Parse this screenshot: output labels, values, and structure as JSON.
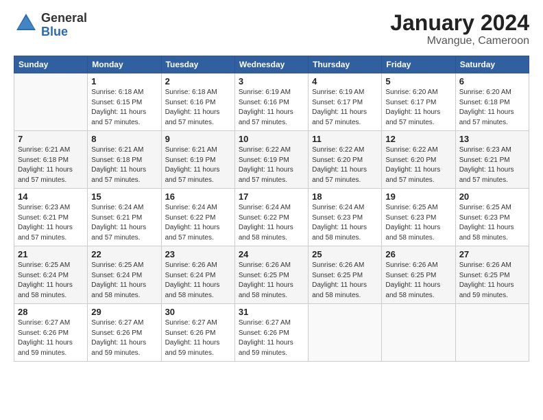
{
  "header": {
    "logo_general": "General",
    "logo_blue": "Blue",
    "month": "January 2024",
    "location": "Mvangue, Cameroon"
  },
  "weekdays": [
    "Sunday",
    "Monday",
    "Tuesday",
    "Wednesday",
    "Thursday",
    "Friday",
    "Saturday"
  ],
  "weeks": [
    [
      {
        "day": "",
        "sunrise": "",
        "sunset": "",
        "daylight": ""
      },
      {
        "day": "1",
        "sunrise": "6:18 AM",
        "sunset": "6:15 PM",
        "daylight": "11 hours and 57 minutes."
      },
      {
        "day": "2",
        "sunrise": "6:18 AM",
        "sunset": "6:16 PM",
        "daylight": "11 hours and 57 minutes."
      },
      {
        "day": "3",
        "sunrise": "6:19 AM",
        "sunset": "6:16 PM",
        "daylight": "11 hours and 57 minutes."
      },
      {
        "day": "4",
        "sunrise": "6:19 AM",
        "sunset": "6:17 PM",
        "daylight": "11 hours and 57 minutes."
      },
      {
        "day": "5",
        "sunrise": "6:20 AM",
        "sunset": "6:17 PM",
        "daylight": "11 hours and 57 minutes."
      },
      {
        "day": "6",
        "sunrise": "6:20 AM",
        "sunset": "6:18 PM",
        "daylight": "11 hours and 57 minutes."
      }
    ],
    [
      {
        "day": "7",
        "sunrise": "6:21 AM",
        "sunset": "6:18 PM",
        "daylight": "11 hours and 57 minutes."
      },
      {
        "day": "8",
        "sunrise": "6:21 AM",
        "sunset": "6:18 PM",
        "daylight": "11 hours and 57 minutes."
      },
      {
        "day": "9",
        "sunrise": "6:21 AM",
        "sunset": "6:19 PM",
        "daylight": "11 hours and 57 minutes."
      },
      {
        "day": "10",
        "sunrise": "6:22 AM",
        "sunset": "6:19 PM",
        "daylight": "11 hours and 57 minutes."
      },
      {
        "day": "11",
        "sunrise": "6:22 AM",
        "sunset": "6:20 PM",
        "daylight": "11 hours and 57 minutes."
      },
      {
        "day": "12",
        "sunrise": "6:22 AM",
        "sunset": "6:20 PM",
        "daylight": "11 hours and 57 minutes."
      },
      {
        "day": "13",
        "sunrise": "6:23 AM",
        "sunset": "6:21 PM",
        "daylight": "11 hours and 57 minutes."
      }
    ],
    [
      {
        "day": "14",
        "sunrise": "6:23 AM",
        "sunset": "6:21 PM",
        "daylight": "11 hours and 57 minutes."
      },
      {
        "day": "15",
        "sunrise": "6:24 AM",
        "sunset": "6:21 PM",
        "daylight": "11 hours and 57 minutes."
      },
      {
        "day": "16",
        "sunrise": "6:24 AM",
        "sunset": "6:22 PM",
        "daylight": "11 hours and 57 minutes."
      },
      {
        "day": "17",
        "sunrise": "6:24 AM",
        "sunset": "6:22 PM",
        "daylight": "11 hours and 58 minutes."
      },
      {
        "day": "18",
        "sunrise": "6:24 AM",
        "sunset": "6:23 PM",
        "daylight": "11 hours and 58 minutes."
      },
      {
        "day": "19",
        "sunrise": "6:25 AM",
        "sunset": "6:23 PM",
        "daylight": "11 hours and 58 minutes."
      },
      {
        "day": "20",
        "sunrise": "6:25 AM",
        "sunset": "6:23 PM",
        "daylight": "11 hours and 58 minutes."
      }
    ],
    [
      {
        "day": "21",
        "sunrise": "6:25 AM",
        "sunset": "6:24 PM",
        "daylight": "11 hours and 58 minutes."
      },
      {
        "day": "22",
        "sunrise": "6:25 AM",
        "sunset": "6:24 PM",
        "daylight": "11 hours and 58 minutes."
      },
      {
        "day": "23",
        "sunrise": "6:26 AM",
        "sunset": "6:24 PM",
        "daylight": "11 hours and 58 minutes."
      },
      {
        "day": "24",
        "sunrise": "6:26 AM",
        "sunset": "6:25 PM",
        "daylight": "11 hours and 58 minutes."
      },
      {
        "day": "25",
        "sunrise": "6:26 AM",
        "sunset": "6:25 PM",
        "daylight": "11 hours and 58 minutes."
      },
      {
        "day": "26",
        "sunrise": "6:26 AM",
        "sunset": "6:25 PM",
        "daylight": "11 hours and 58 minutes."
      },
      {
        "day": "27",
        "sunrise": "6:26 AM",
        "sunset": "6:25 PM",
        "daylight": "11 hours and 59 minutes."
      }
    ],
    [
      {
        "day": "28",
        "sunrise": "6:27 AM",
        "sunset": "6:26 PM",
        "daylight": "11 hours and 59 minutes."
      },
      {
        "day": "29",
        "sunrise": "6:27 AM",
        "sunset": "6:26 PM",
        "daylight": "11 hours and 59 minutes."
      },
      {
        "day": "30",
        "sunrise": "6:27 AM",
        "sunset": "6:26 PM",
        "daylight": "11 hours and 59 minutes."
      },
      {
        "day": "31",
        "sunrise": "6:27 AM",
        "sunset": "6:26 PM",
        "daylight": "11 hours and 59 minutes."
      },
      {
        "day": "",
        "sunrise": "",
        "sunset": "",
        "daylight": ""
      },
      {
        "day": "",
        "sunrise": "",
        "sunset": "",
        "daylight": ""
      },
      {
        "day": "",
        "sunrise": "",
        "sunset": "",
        "daylight": ""
      }
    ]
  ]
}
